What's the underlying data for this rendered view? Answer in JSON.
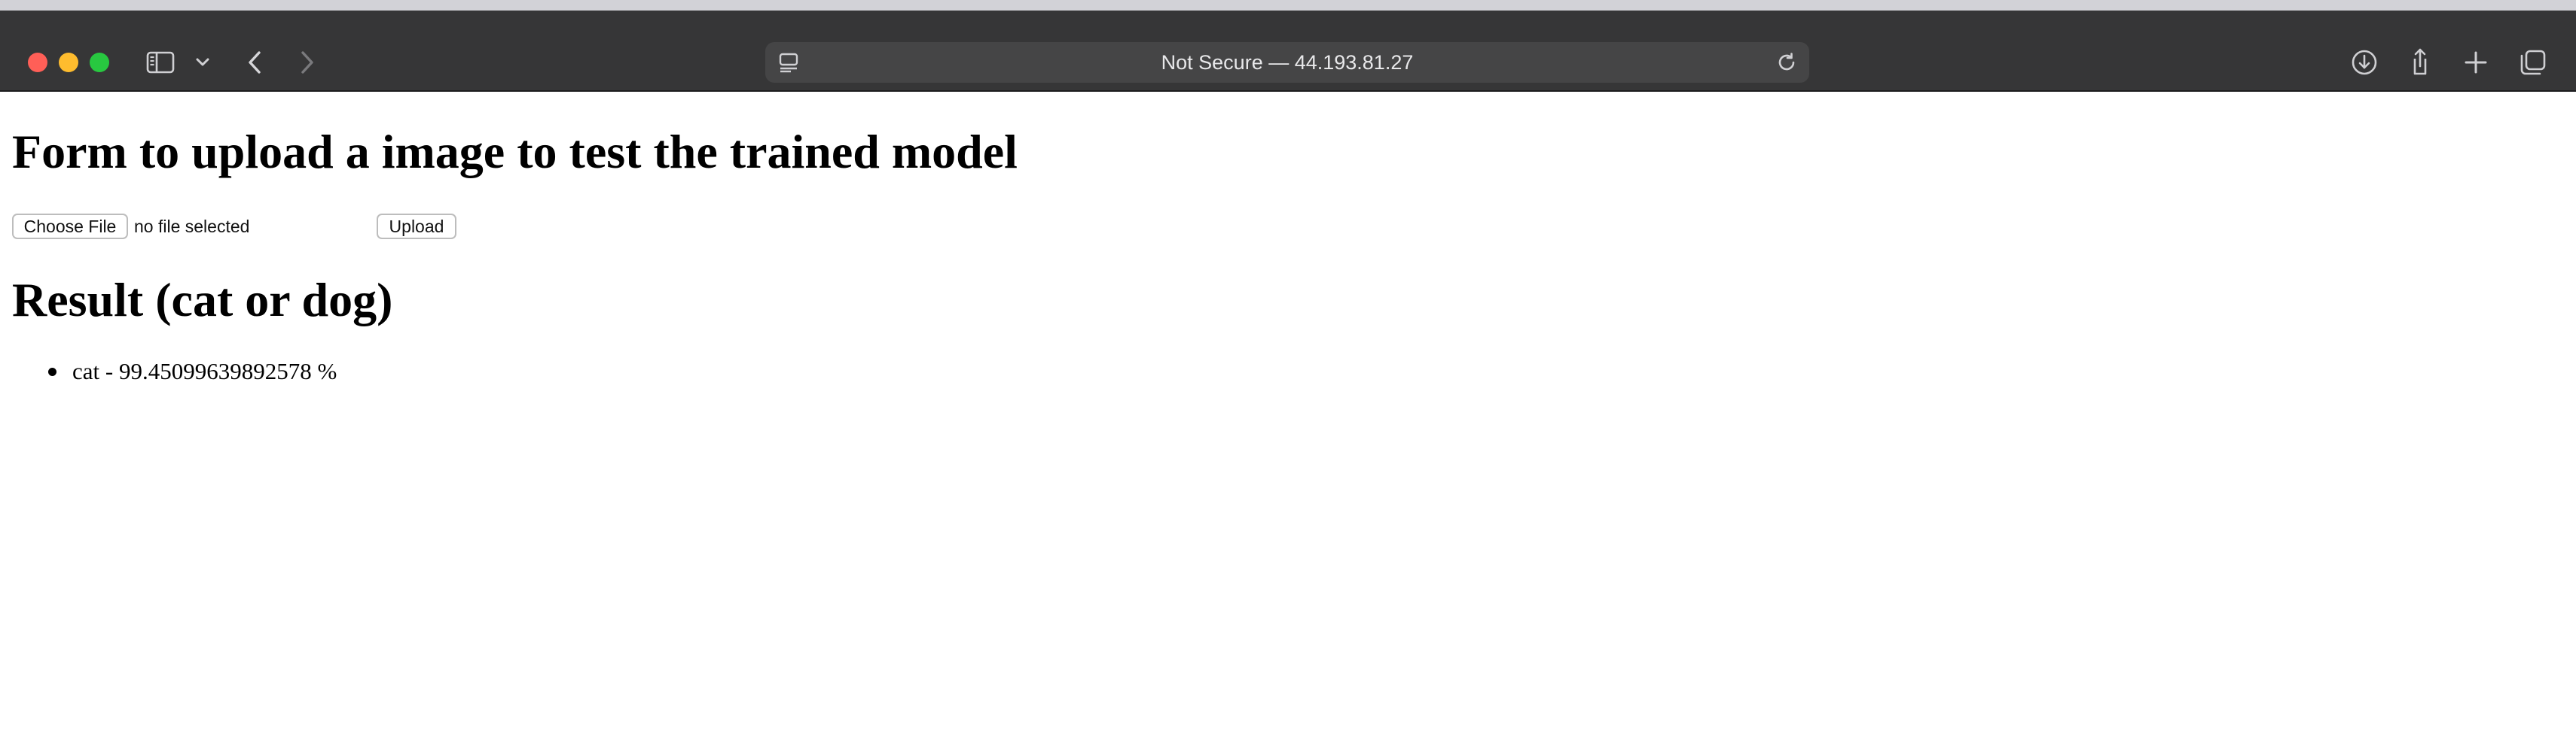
{
  "browser": {
    "address": "Not Secure — 44.193.81.27",
    "icons": {
      "sidebar": "sidebar-icon",
      "tab_overview_menu": "chevron-down-icon",
      "back": "chevron-left-icon",
      "forward": "chevron-right-icon",
      "site_settings": "site-settings-icon",
      "reload": "reload-icon",
      "downloads": "download-icon",
      "share": "share-icon",
      "new_tab": "plus-icon",
      "tab_overview": "tabs-icon"
    }
  },
  "page": {
    "form_title": "Form to upload a image to test the trained model",
    "choose_file_label": "Choose File",
    "file_status": "no file selected",
    "upload_label": "Upload",
    "result_title": "Result (cat or dog)",
    "results": [
      {
        "text": "cat - 99.45099639892578 %"
      }
    ]
  },
  "colors": {
    "toolbar": "#363637",
    "address_bar": "#454546",
    "close": "#ff5f57",
    "minimize": "#febc2e",
    "zoom": "#28c840"
  }
}
